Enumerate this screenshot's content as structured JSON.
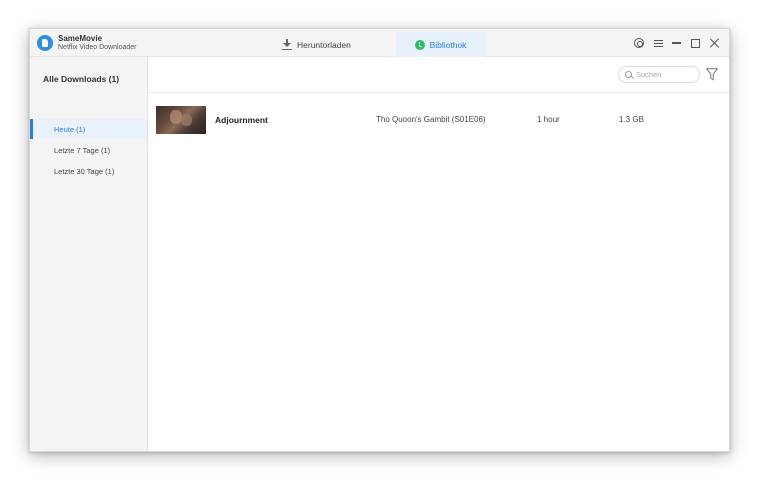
{
  "app": {
    "name": "SameMovie",
    "subtitle": "Netflix Video Downloader"
  },
  "tabs": [
    {
      "label": "Heruntorladen",
      "icon": "download-icon",
      "active": false
    },
    {
      "label": "Bibliothok",
      "icon": "library-icon",
      "active": true
    }
  ],
  "sidebar": {
    "heading": "Alle Downloads (1)",
    "items": [
      {
        "label": "Heute (1)",
        "active": true
      },
      {
        "label": "Letzte 7 Tage (1)",
        "active": false
      },
      {
        "label": "Letzte 30 Tage (1)",
        "active": false
      }
    ]
  },
  "search": {
    "placeholder": "Suchen",
    "value": ""
  },
  "downloads": [
    {
      "title": "Adjournment",
      "series": "Tho Quoon's Gambit (S01E06)",
      "duration": "1 hour",
      "size": "1.3 GB"
    }
  ],
  "colors": {
    "accent": "#2a7fd4",
    "library_icon": "#2ebd6a",
    "active_bg": "#e9f2fc"
  }
}
